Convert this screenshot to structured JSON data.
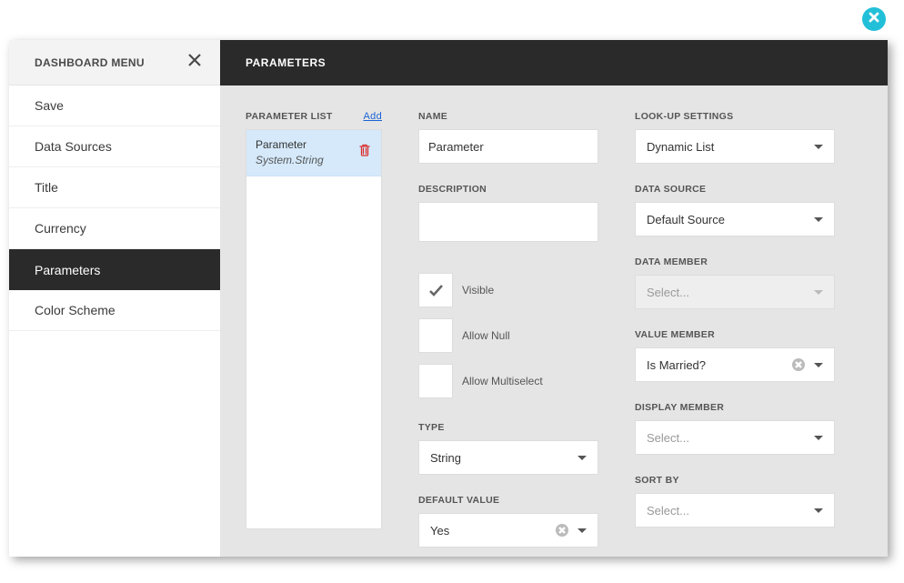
{
  "close_label": "Close",
  "sidebar": {
    "title": "DASHBOARD MENU",
    "items": [
      {
        "label": "Save",
        "active": false
      },
      {
        "label": "Data Sources",
        "active": false
      },
      {
        "label": "Title",
        "active": false
      },
      {
        "label": "Currency",
        "active": false
      },
      {
        "label": "Parameters",
        "active": true
      },
      {
        "label": "Color Scheme",
        "active": false
      }
    ]
  },
  "main": {
    "header": "PARAMETERS",
    "list": {
      "label": "PARAMETER LIST",
      "add": "Add",
      "item": {
        "name": "Parameter",
        "type": "System.String"
      }
    },
    "fields": {
      "name": {
        "label": "NAME",
        "value": "Parameter"
      },
      "description": {
        "label": "DESCRIPTION",
        "value": ""
      },
      "visible": {
        "label": "Visible",
        "checked": true
      },
      "allow_null": {
        "label": "Allow Null",
        "checked": false
      },
      "allow_multiselect": {
        "label": "Allow Multiselect",
        "checked": false
      },
      "type": {
        "label": "TYPE",
        "value": "String"
      },
      "default_value": {
        "label": "DEFAULT VALUE",
        "value": "Yes"
      }
    },
    "lookup": {
      "settings": {
        "label": "LOOK-UP SETTINGS",
        "value": "Dynamic List"
      },
      "data_source": {
        "label": "DATA SOURCE",
        "value": "Default Source"
      },
      "data_member": {
        "label": "DATA MEMBER",
        "placeholder": "Select...",
        "disabled": true
      },
      "value_member": {
        "label": "VALUE MEMBER",
        "value": "Is Married?"
      },
      "display_member": {
        "label": "DISPLAY MEMBER",
        "placeholder": "Select..."
      },
      "sort_by": {
        "label": "SORT BY",
        "placeholder": "Select..."
      }
    }
  }
}
